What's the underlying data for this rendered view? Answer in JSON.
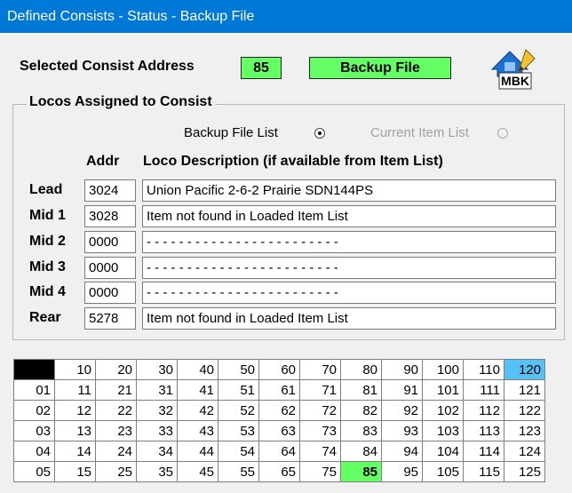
{
  "window": {
    "title": "Defined Consists - Status - Backup File"
  },
  "header": {
    "selected_label": "Selected Consist Address",
    "address_value": "85",
    "source_badge": "Backup File",
    "logo_text": "MBK",
    "logo_icon": "mbk-logo-icon"
  },
  "group": {
    "title": "Locos Assigned to Consist",
    "radio_backup_label": "Backup File List",
    "radio_current_label": "Current Item List",
    "radio_backup_checked": true,
    "radio_current_enabled": false,
    "col_addr": "Addr",
    "col_desc": "Loco Description (if available from Item List)",
    "rows": [
      {
        "label": "Lead",
        "addr": "3024",
        "desc": "Union Pacific 2-6-2 Prairie SDN144PS"
      },
      {
        "label": "Mid 1",
        "addr": "3028",
        "desc": "Item not found in Loaded Item List"
      },
      {
        "label": "Mid 2",
        "addr": "0000",
        "desc": "- - - - - - - - - - - - - - - - - - - - - - - -"
      },
      {
        "label": "Mid 3",
        "addr": "0000",
        "desc": "- - - - - - - - - - - - - - - - - - - - - - - -"
      },
      {
        "label": "Mid 4",
        "addr": "0000",
        "desc": "- - - - - - - - - - - - - - - - - - - - - - - -"
      },
      {
        "label": "Rear",
        "addr": "5278",
        "desc": "Item not found in Loaded Item List"
      }
    ]
  },
  "grid": {
    "rows": [
      [
        "",
        "10",
        "20",
        "30",
        "40",
        "50",
        "60",
        "70",
        "80",
        "90",
        "100",
        "110",
        "120"
      ],
      [
        "01",
        "11",
        "21",
        "31",
        "41",
        "51",
        "61",
        "71",
        "81",
        "91",
        "101",
        "111",
        "121"
      ],
      [
        "02",
        "12",
        "22",
        "32",
        "42",
        "52",
        "62",
        "72",
        "82",
        "92",
        "102",
        "112",
        "122"
      ],
      [
        "03",
        "13",
        "23",
        "33",
        "43",
        "53",
        "63",
        "73",
        "83",
        "93",
        "103",
        "113",
        "123"
      ],
      [
        "04",
        "14",
        "24",
        "34",
        "44",
        "54",
        "64",
        "74",
        "84",
        "94",
        "104",
        "114",
        "124"
      ],
      [
        "05",
        "15",
        "25",
        "35",
        "45",
        "55",
        "65",
        "75",
        "85",
        "95",
        "105",
        "115",
        "125"
      ]
    ],
    "highlight_blue": "120",
    "highlight_green": "85",
    "colors": {
      "blue": "#55c1f5",
      "green": "#64ff64",
      "titlebar": "#0078d7"
    }
  }
}
